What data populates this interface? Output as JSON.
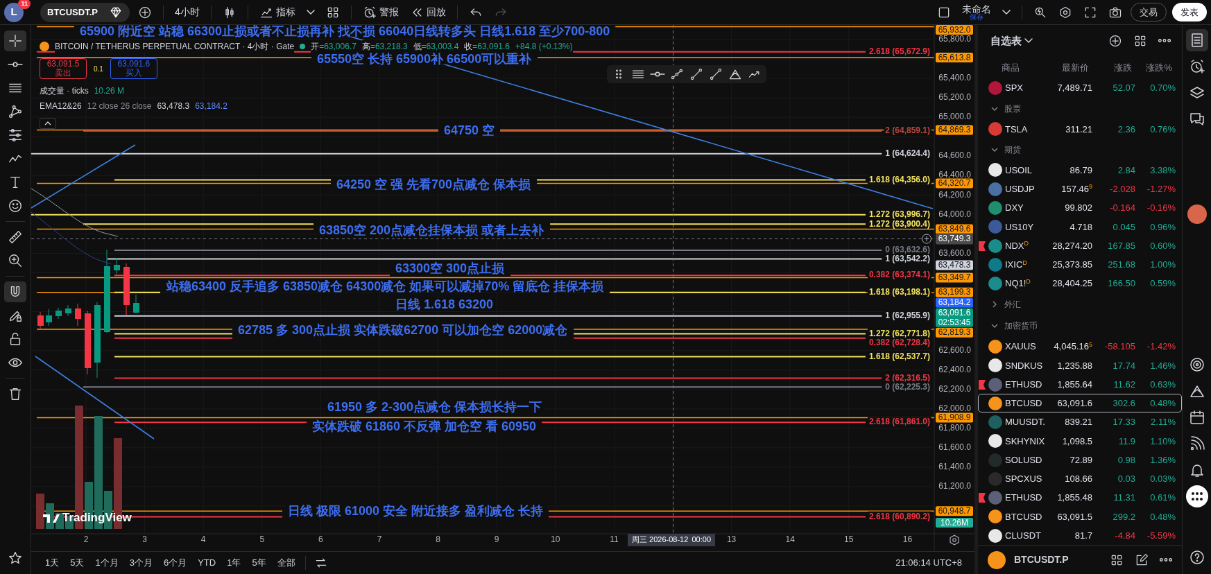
{
  "top_bar": {
    "avatar": "L",
    "notifications": "11",
    "symbol": "BTCUSDT.P",
    "interval": "4小时",
    "indicators": "指标",
    "alert": "警报",
    "replay": "回放",
    "layout_name": "未命名",
    "layout_status": "保存",
    "trade": "交易",
    "publish": "发表"
  },
  "legend": {
    "title": "BITCOIN / TETHERUS PERPETUAL CONTRACT · 4小时 · Gate",
    "ohlc": [
      {
        "label": "开",
        "value": "=63,006.7"
      },
      {
        "label": "高",
        "value": "=63,218.3"
      },
      {
        "label": "低",
        "value": "=63,003.4"
      },
      {
        "label": "收",
        "value": "=63,091.6"
      }
    ],
    "change": "+84.8 (+0.13%)",
    "sell": {
      "price": "63,091.5",
      "label": "卖出"
    },
    "spread": "0.1",
    "buy": {
      "price": "63,091.6",
      "label": "买入"
    },
    "volume": {
      "name": "成交量 · ticks",
      "value": "10.26 M"
    },
    "ema": {
      "name": "EMA12&26",
      "params": "12 close 26 close",
      "values": [
        "63,478.3",
        "63,184.2"
      ]
    }
  },
  "annotations": [
    "65900 附近空  站稳  66300止损或者不止损再补  找不损 66040日线转多头  日线1.618   至少700-800",
    "65550空 长持   65900补  66500可以重补",
    "64750 空",
    "64250 空  强  先看700点减仓 保本损",
    "63850空  200点减仓挂保本损 或者上去补",
    "63300空  300点止损",
    "站稳63400  反手追多   63850减仓 64300减仓 如果可以减掉70% 留底仓 挂保本损",
    "日线 1.618  63200",
    "62785 多 300点止损 实体跌破62700   可以加仓空 62000减仓",
    "61950  多  2-300点减仓 保本损长持一下",
    "实体跌破 61860    不反弹 加仓空 看  60950",
    "日线  极限  61000 安全  附近接多   盈利减仓 长持"
  ],
  "levels": [
    {
      "label": "2.618 (65,672.9)",
      "color": "#f23645"
    },
    {
      "label": "2 (64,859.1)",
      "color": "#b8483e"
    },
    {
      "label": "1 (64,624.4)",
      "color": "#d1d4dc"
    },
    {
      "label": "1.618 (64,356.0)",
      "color": "#f2e35e"
    },
    {
      "label": "1.272 (63,996.7)",
      "color": "#f2e35e"
    },
    {
      "label": "1.272 (63,900.4)",
      "color": "#f2e35e"
    },
    {
      "label": "0 (63,632.6)",
      "color": "#787b86"
    },
    {
      "label": "1 (63,542.2)",
      "color": "#d1d4dc"
    },
    {
      "label": "0.382 (63,374.1)",
      "color": "#f23645"
    },
    {
      "label": "1.618 (63,198.1)",
      "color": "#f2e35e"
    },
    {
      "label": "1 (62,955.9)",
      "color": "#d1d4dc"
    },
    {
      "label": "1.272 (62,771.8)",
      "color": "#f2e35e"
    },
    {
      "label": "0.382 (62,728.4)",
      "color": "#f23645"
    },
    {
      "label": "1.618 (62,537.7)",
      "color": "#f2e35e"
    },
    {
      "label": "2 (62,316.5)",
      "color": "#f23645"
    },
    {
      "label": "0 (62,225.3)",
      "color": "#787b86"
    },
    {
      "label": "2.618 (61,861.0)",
      "color": "#f23645"
    },
    {
      "label": "2.618 (60,890.2)",
      "color": "#f23645"
    }
  ],
  "price_axis": [
    "65,800.0",
    "65,400.0",
    "65,200.0",
    "65,000.0",
    "64,600.0",
    "64,400.0",
    "64,200.0",
    "64,000.0",
    "63,600.0",
    "62,600.0",
    "62,400.0",
    "62,200.0",
    "62,000.0",
    "61,800.0",
    "61,600.0",
    "61,400.0",
    "61,200.0"
  ],
  "price_tags": [
    {
      "kind": "price",
      "text": "65,932.0",
      "color": "#ff9800"
    },
    {
      "kind": "price",
      "text": "65,613.8",
      "color": "#ff9800"
    },
    {
      "kind": "price",
      "text": "64,869.3",
      "color": "#ff9800"
    },
    {
      "kind": "price",
      "text": "64,320.7",
      "color": "#ff9800"
    },
    {
      "kind": "price",
      "text": "63,849.6",
      "color": "#ff9800"
    },
    {
      "kind": "price",
      "text": "63,478.3",
      "color": "#d1d4dc"
    },
    {
      "kind": "price",
      "text": "63,349.7",
      "color": "#ff9800"
    },
    {
      "kind": "price",
      "text": "63,199.3",
      "color": "#ff9800"
    },
    {
      "kind": "price",
      "text": "63,184.2",
      "color": "#2962ff"
    },
    {
      "kind": "price",
      "text": "63,091.6",
      "sub": "02:53:45",
      "color": "#089981"
    },
    {
      "kind": "price",
      "text": "62,819.3",
      "color": "#ff9800"
    },
    {
      "kind": "price",
      "text": "61,908.9",
      "color": "#ff9800"
    },
    {
      "kind": "price",
      "text": "60,948.7",
      "color": "#ff9800"
    },
    {
      "kind": "volume",
      "text": "10.26M",
      "color": "#22ab94"
    }
  ],
  "crosshair": {
    "price": "63,749.3",
    "date": "周三 2026-08-12",
    "time": "00:00"
  },
  "time_axis": [
    "2",
    "3",
    "4",
    "5",
    "6",
    "7",
    "8",
    "9",
    "10",
    "11",
    "13",
    "14",
    "15",
    "16"
  ],
  "logo": "TradingView",
  "range_bar": {
    "ranges": [
      "1天",
      "5天",
      "1个月",
      "3个月",
      "6个月",
      "YTD",
      "1年",
      "5年",
      "全部"
    ],
    "clock": "21:06:14 UTC+8"
  },
  "watchlist": {
    "title": "自选表",
    "columns": [
      "商品",
      "最新价",
      "涨跌",
      "涨跌%"
    ],
    "rows": [
      {
        "kind": "item",
        "symbol": "SPX",
        "price": "7,489.71",
        "change": "52.07",
        "percent": "0.70%",
        "rising": true,
        "color": "#b2163a",
        "flagged": false,
        "selected": false
      },
      {
        "kind": "group",
        "label": "股票",
        "expanded": true
      },
      {
        "kind": "item",
        "symbol": "TSLA",
        "price": "311.21",
        "change": "2.36",
        "percent": "0.76%",
        "rising": true,
        "color": "#d83a34",
        "flagged": false,
        "selected": false
      },
      {
        "kind": "group",
        "label": "期货",
        "expanded": true
      },
      {
        "kind": "item",
        "symbol": "USOIL",
        "price": "86.79",
        "change": "2.84",
        "percent": "3.38%",
        "rising": true,
        "color": "#e8e8e8",
        "flagged": false,
        "selected": false
      },
      {
        "kind": "item",
        "symbol": "USDJP",
        "price": "157.46$^{9}$",
        "change": "-2.028",
        "percent": "-1.27%",
        "rising": false,
        "color": "#4a6fa5",
        "flagged": false,
        "selected": false
      },
      {
        "kind": "item",
        "symbol": "DXY",
        "price": "99.802",
        "change": "-0.164",
        "percent": "-0.16%",
        "rising": false,
        "color": "#1e8e6e",
        "flagged": false,
        "selected": false
      },
      {
        "kind": "item",
        "symbol": "US10Y",
        "price": "4.718",
        "change": "0.045",
        "percent": "0.96%",
        "rising": true,
        "color": "#3c5a99",
        "flagged": false,
        "selected": false
      },
      {
        "kind": "item",
        "symbol": "NDX$^{D}$",
        "price": "28,274.20",
        "change": "167.85",
        "percent": "0.60%",
        "rising": true,
        "color": "#1b8c8c",
        "flagged": true,
        "selected": false
      },
      {
        "kind": "item",
        "symbol": "IXIC$^{D}$",
        "price": "25,373.85",
        "change": "251.68",
        "percent": "1.00%",
        "rising": true,
        "color": "#0f7a8a",
        "flagged": false,
        "selected": false
      },
      {
        "kind": "item",
        "symbol": "NQ1!$^{D}$",
        "price": "28,404.25",
        "change": "166.50",
        "percent": "0.59%",
        "rising": true,
        "color": "#1b8c8c",
        "flagged": false,
        "selected": false
      },
      {
        "kind": "group",
        "label": "外汇",
        "expanded": false
      },
      {
        "kind": "group",
        "label": "加密货币",
        "expanded": true
      },
      {
        "kind": "item",
        "symbol": "XAUUS",
        "price": "4,045.16$^{5}$",
        "change": "-58.105",
        "percent": "-1.42%",
        "rising": false,
        "color": "#f7931a",
        "flagged": false,
        "selected": false
      },
      {
        "kind": "item",
        "symbol": "SNDKUS",
        "price": "1,235.88",
        "change": "17.74",
        "percent": "1.46%",
        "rising": true,
        "color": "#e8e8e8",
        "flagged": false,
        "selected": false
      },
      {
        "kind": "item",
        "symbol": "ETHUSD",
        "price": "1,855.64",
        "change": "11.62",
        "percent": "0.63%",
        "rising": true,
        "color": "#5b6078",
        "flagged": true,
        "selected": false
      },
      {
        "kind": "item",
        "symbol": "BTCUSD",
        "price": "63,091.6",
        "change": "302.6",
        "percent": "0.48%",
        "rising": true,
        "color": "#f7931a",
        "flagged": false,
        "selected": true
      },
      {
        "kind": "item",
        "symbol": "MUUSDT.",
        "price": "839.21",
        "change": "17.33",
        "percent": "2.11%",
        "rising": true,
        "color": "#1f5f5f",
        "flagged": false,
        "selected": false
      },
      {
        "kind": "item",
        "symbol": "SKHYNIX",
        "price": "1,098.5",
        "change": "11.9",
        "percent": "1.10%",
        "rising": true,
        "color": "#e8e8e8",
        "flagged": false,
        "selected": false
      },
      {
        "kind": "item",
        "symbol": "SOLUSD",
        "price": "72.89",
        "change": "0.98",
        "percent": "1.36%",
        "rising": true,
        "color": "#222a2a",
        "flagged": false,
        "selected": false
      },
      {
        "kind": "item",
        "symbol": "SPCXUS",
        "price": "108.66",
        "change": "0.03",
        "percent": "0.03%",
        "rising": true,
        "color": "#2a2a2a",
        "flagged": false,
        "selected": false
      },
      {
        "kind": "item",
        "symbol": "ETHUSD",
        "price": "1,855.48",
        "change": "11.31",
        "percent": "0.61%",
        "rising": true,
        "color": "#5b6078",
        "flagged": true,
        "selected": false
      },
      {
        "kind": "item",
        "symbol": "BTCUSD",
        "price": "63,091.5",
        "change": "299.2",
        "percent": "0.48%",
        "rising": true,
        "color": "#f7931a",
        "flagged": false,
        "selected": false
      },
      {
        "kind": "item",
        "symbol": "CLUSDT",
        "price": "81.7",
        "change": "-4.84",
        "percent": "-5.59%",
        "rising": false,
        "color": "#e8e8e8",
        "flagged": false,
        "selected": false
      }
    ],
    "footer_symbol": "BTCUSDT.P"
  }
}
